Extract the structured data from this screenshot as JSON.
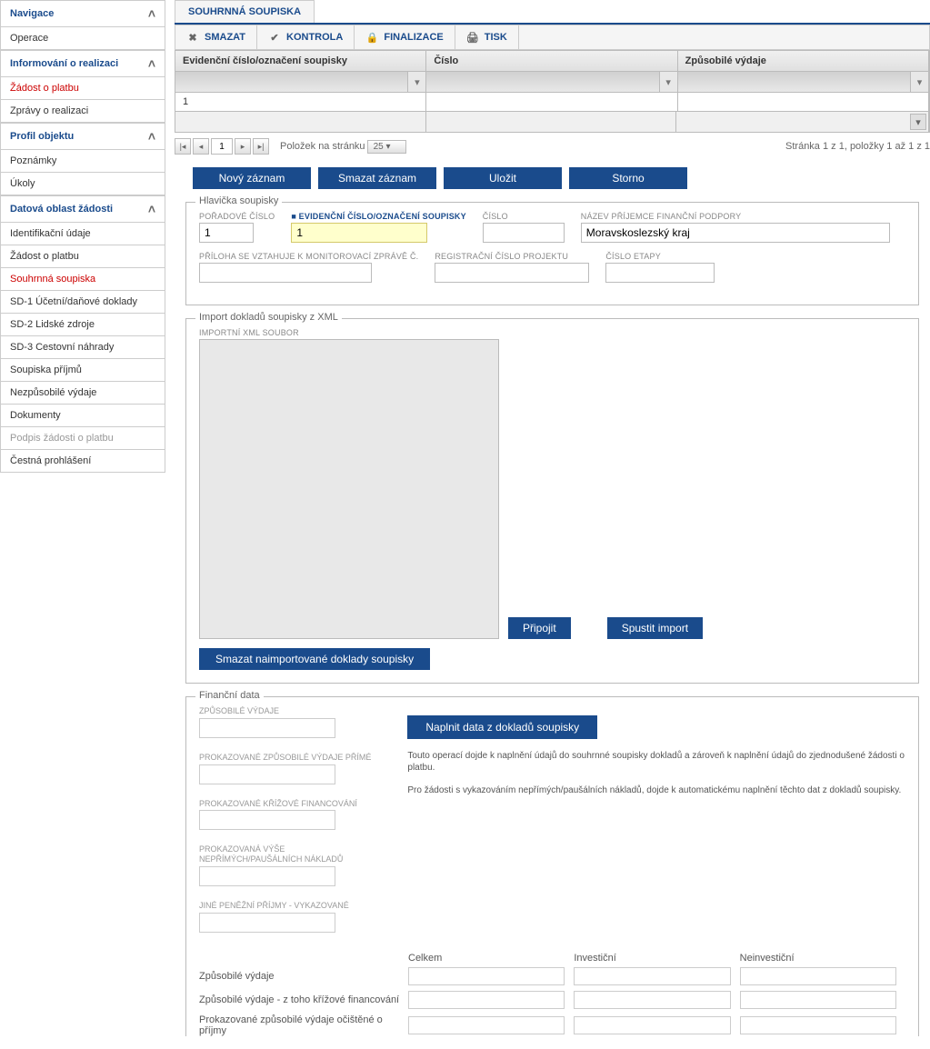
{
  "sidebar": {
    "sections": [
      {
        "title": "Navigace",
        "items": [
          "Operace"
        ]
      },
      {
        "title": "Informování o realizaci",
        "items_styled": [
          {
            "label": "Žádost o platbu",
            "cls": "red"
          },
          {
            "label": "Zprávy o realizaci",
            "cls": ""
          }
        ]
      },
      {
        "title": "Profil objektu",
        "items": [
          "Poznámky",
          "Úkoly"
        ]
      },
      {
        "title": "Datová oblast žádosti",
        "items_styled": [
          {
            "label": "Identifikační údaje",
            "cls": ""
          },
          {
            "label": "Žádost o platbu",
            "cls": ""
          },
          {
            "label": "Souhrnná soupiska",
            "cls": "red"
          },
          {
            "label": "SD-1 Účetní/daňové doklady",
            "cls": ""
          },
          {
            "label": "SD-2 Lidské zdroje",
            "cls": ""
          },
          {
            "label": "SD-3 Cestovní náhrady",
            "cls": ""
          },
          {
            "label": "Soupiska příjmů",
            "cls": ""
          },
          {
            "label": "Nezpůsobilé výdaje",
            "cls": ""
          },
          {
            "label": "Dokumenty",
            "cls": ""
          },
          {
            "label": "Podpis žádosti o platbu",
            "cls": "disabled"
          },
          {
            "label": "Čestná prohlášení",
            "cls": ""
          }
        ]
      }
    ]
  },
  "tab": "SOUHRNNÁ SOUPISKA",
  "toolbar": {
    "smazat": "SMAZAT",
    "kontrola": "KONTROLA",
    "finalizace": "FINALIZACE",
    "tisk": "TISK"
  },
  "table": {
    "headers": [
      "Evidenční číslo/označení soupisky",
      "Číslo",
      "Způsobilé výdaje"
    ],
    "row1": "1"
  },
  "pager": {
    "page": "1",
    "label": "Položek na stránku",
    "pagesize": "25",
    "info": "Stránka 1 z 1, položky 1 až 1 z 1"
  },
  "actions": {
    "novy": "Nový záznam",
    "smazat": "Smazat záznam",
    "ulozit": "Uložit",
    "storno": "Storno"
  },
  "hlavicka": {
    "legend": "Hlavička soupisky",
    "poradove_label": "POŘADOVÉ ČÍSLO",
    "poradove_value": "1",
    "evidencni_label": "EVIDENČNÍ ČÍSLO/OZNAČENÍ SOUPISKY",
    "evidencni_value": "1",
    "cislo_label": "ČÍSLO",
    "nazev_label": "NÁZEV PŘÍJEMCE FINANČNÍ PODPORY",
    "nazev_value": "Moravskoslezský kraj",
    "priloha_label": "PŘÍLOHA SE VZTAHUJE K MONITOROVACÍ ZPRÁVĚ Č.",
    "reg_label": "REGISTRAČNÍ ČÍSLO PROJEKTU",
    "etapa_label": "ČÍSLO ETAPY"
  },
  "import": {
    "legend": "Import dokladů soupisky z XML",
    "input_label": "IMPORTNÍ XML SOUBOR",
    "pripojit": "Připojit",
    "spustit": "Spustit import",
    "smazat_imp": "Smazat naimportované doklady soupisky"
  },
  "fin": {
    "legend": "Finanční data",
    "zpusobile": "ZPŮSOBILÉ VÝDAJE",
    "prokazovane": "PROKAZOVANÉ ZPŮSOBILÉ VÝDAJE PŘÍMÉ",
    "krizove": "PROKAZOVANÉ KŘÍŽOVÉ FINANCOVÁNÍ",
    "neprime": "PROKAZOVANÁ VÝŠE NEPŘÍMÝCH/PAUŠÁLNÍCH NÁKLADŮ",
    "jine": "JINÉ PENĚŽNÍ PŘÍJMY - VYKAZOVANÉ",
    "naplnit": "Naplnit data z dokladů soupisky",
    "note1": "Touto operací dojde k naplnění údajů do souhrnné soupisky dokladů a zároveň k naplnění údajů do zjednodušené žádosti o platbu.",
    "note2": "Pro žádosti s vykazováním nepřímých/paušálních nákladů, dojde k automatickému naplnění těchto dat z dokladů soupisky.",
    "sum_cols": [
      "Celkem",
      "Investiční",
      "Neinvestiční"
    ],
    "sum_rows": [
      "Způsobilé výdaje",
      "Způsobilé výdaje - z toho křížové financování",
      "Prokazované způsobilé výdaje očištěné o příjmy"
    ]
  }
}
